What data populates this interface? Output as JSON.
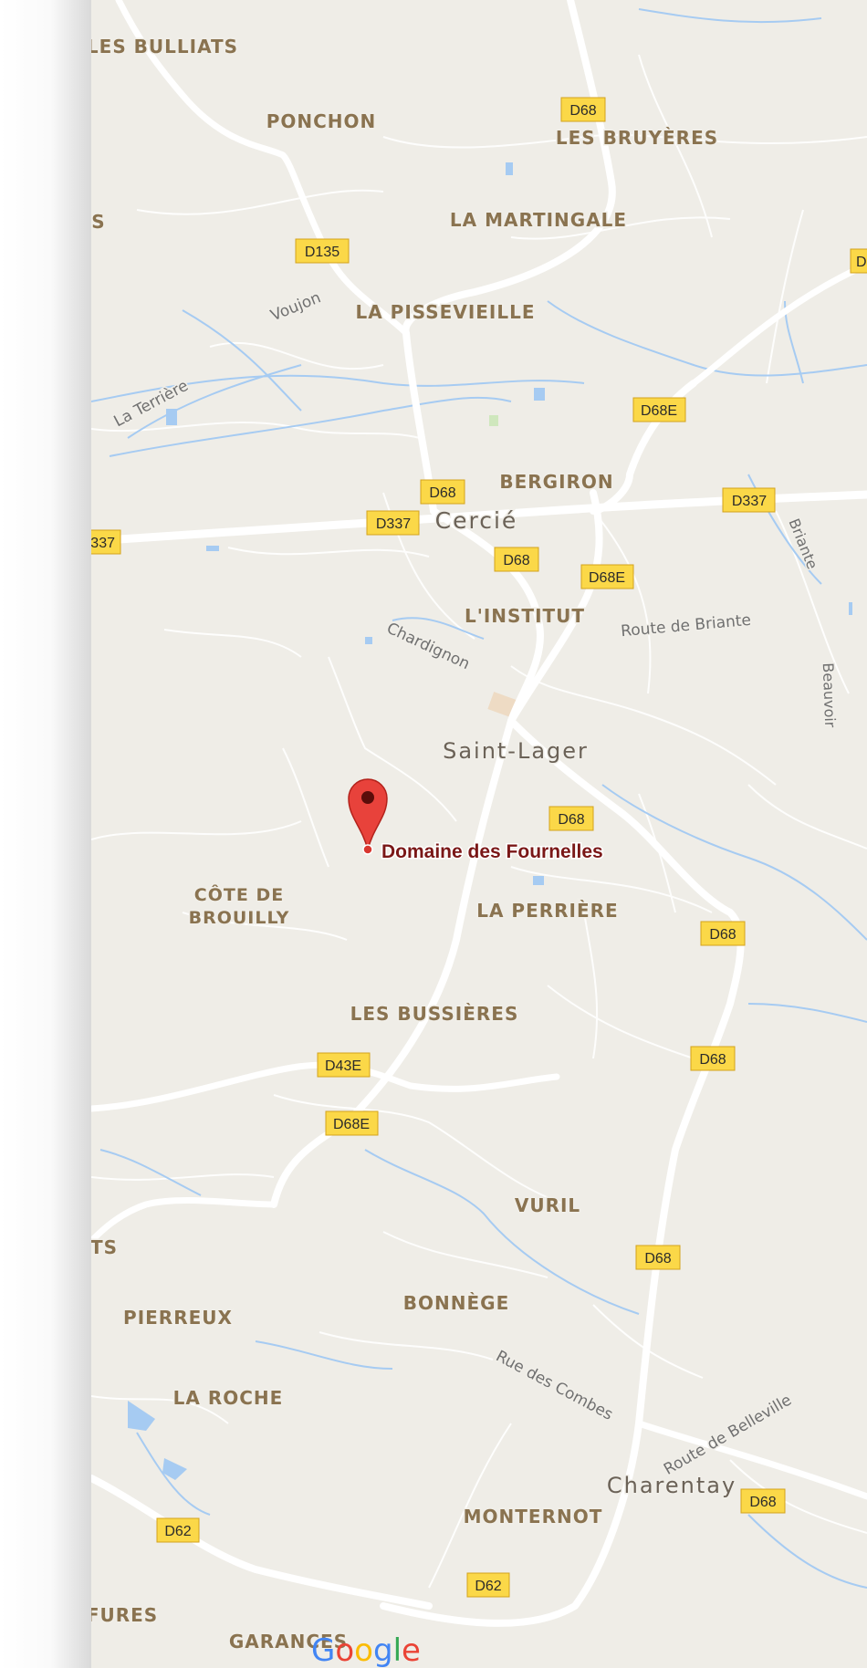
{
  "map": {
    "marker_label": "Domaine des Fournelles",
    "attribution": {
      "letters": [
        "G",
        "o",
        "o",
        "g",
        "l",
        "e"
      ],
      "colors": [
        "#4285F4",
        "#EA4335",
        "#FBBC05",
        "#4285F4",
        "#34A853",
        "#EA4335"
      ]
    },
    "colors": {
      "land": "#efede7",
      "road": "#ffffff",
      "water": "#a6cbf2",
      "shield_fill": "#fbd848",
      "shield_border": "#d3a21d",
      "marker": "#e8423b"
    },
    "places": [
      "LES BULLIATS",
      "PONCHON",
      "LES BRUYÈRES",
      "LA MARTINGALE",
      "S",
      "LA PISSEVIEILLE",
      "BERGIRON",
      "L'INSTITUT",
      "LA PERRIÈRE",
      "CÔTE DE",
      "BROUILLY",
      "LES BUSSIÈRES",
      "VURIL",
      "TS",
      "PIERREUX",
      "BONNÈGE",
      "LA ROCHE",
      "MONTERNOT",
      "FURES",
      "GARANCES"
    ],
    "towns": [
      "Cercié",
      "Saint-Lager",
      "Charentay"
    ],
    "streets": [
      "Voujon",
      "La Terrière",
      "Chardignon",
      "Route de Briante",
      "Briante",
      "Beauvoir",
      "Rue des Combes",
      "Route de Belleville"
    ],
    "road_shields": [
      "D68",
      "D135",
      "D",
      "D68E",
      "D68",
      "D337",
      "D337",
      "337",
      "D68",
      "D68E",
      "D68",
      "D68",
      "D68",
      "D43E",
      "D68E",
      "D68",
      "D62",
      "D68",
      "D62"
    ]
  }
}
